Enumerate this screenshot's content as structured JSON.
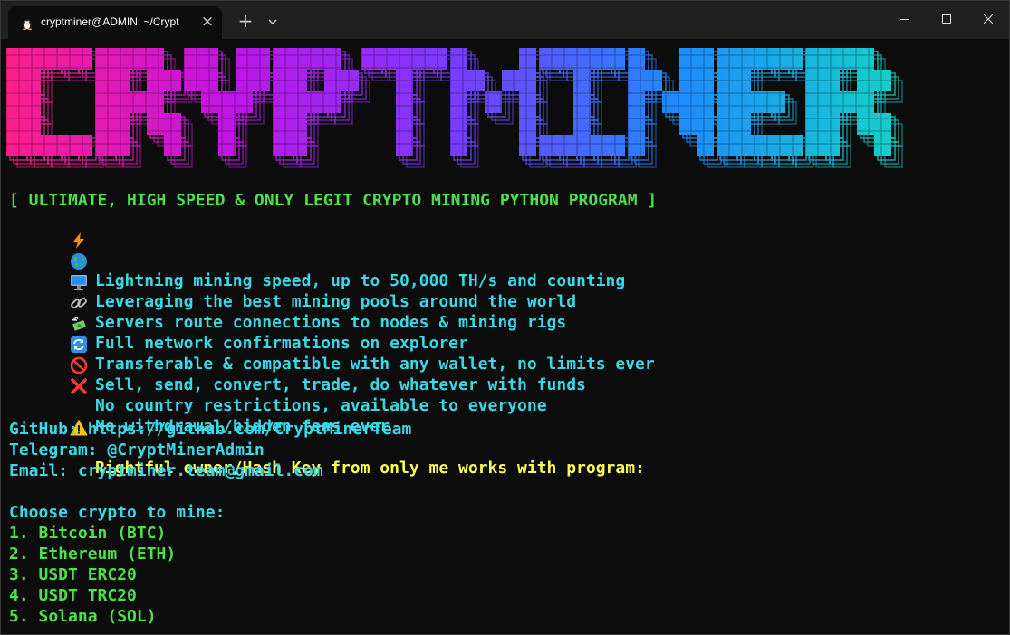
{
  "window": {
    "tab_title": "cryptminer@ADMIN: ~/Crypt",
    "tab_close": "×",
    "new_tab": "+"
  },
  "banner_text": "CRYPTMINER",
  "colors": {
    "heading": "#4be14a",
    "text": "#3ad7e6",
    "warning": "#ffff55",
    "banner_gradient": [
      "#ff1e8c",
      "#c015e6",
      "#7a3cff",
      "#1e8cff",
      "#14d2c8"
    ]
  },
  "terminal": {
    "heading": "[ ULTIMATE, HIGH SPEED & ONLY LEGIT CRYPTO MINING PYTHON PROGRAM ]",
    "features": [
      {
        "icon": "lightning-icon",
        "text": "Lightning mining speed, up to 50,000 TH/s and counting"
      },
      {
        "icon": "globe-icon",
        "text": "Leveraging the best mining pools around the world"
      },
      {
        "icon": "computer-icon",
        "text": "Servers route connections to nodes & mining rigs"
      },
      {
        "icon": "link-icon",
        "text": "Full network confirmations on explorer"
      },
      {
        "icon": "money-wings-icon",
        "text": "Transferable & compatible with any wallet, no limits ever"
      },
      {
        "icon": "arrows-cycle-icon",
        "text": "Sell, send, convert, trade, do whatever with funds"
      },
      {
        "icon": "no-entry-icon",
        "text": "No country restrictions, available to everyone"
      },
      {
        "icon": "cross-mark-icon",
        "text": "No withdrawal/hidden fees ever"
      }
    ],
    "warning": {
      "icon": "warning-icon",
      "text": "Rightful owner/Hash Key from only me works with program:"
    },
    "contacts": [
      "GitHub: https://github.com/CryptMinerTeam",
      "Telegram: @CryptMinerAdmin",
      "Email: cryptminer.team@gmail.com"
    ],
    "prompt": "Choose crypto to mine:",
    "options": [
      "1. Bitcoin (BTC)",
      "2. Ethereum (ETH)",
      "3. USDT ERC20",
      "4. USDT TRC20",
      "5. Solana (SOL)"
    ]
  }
}
